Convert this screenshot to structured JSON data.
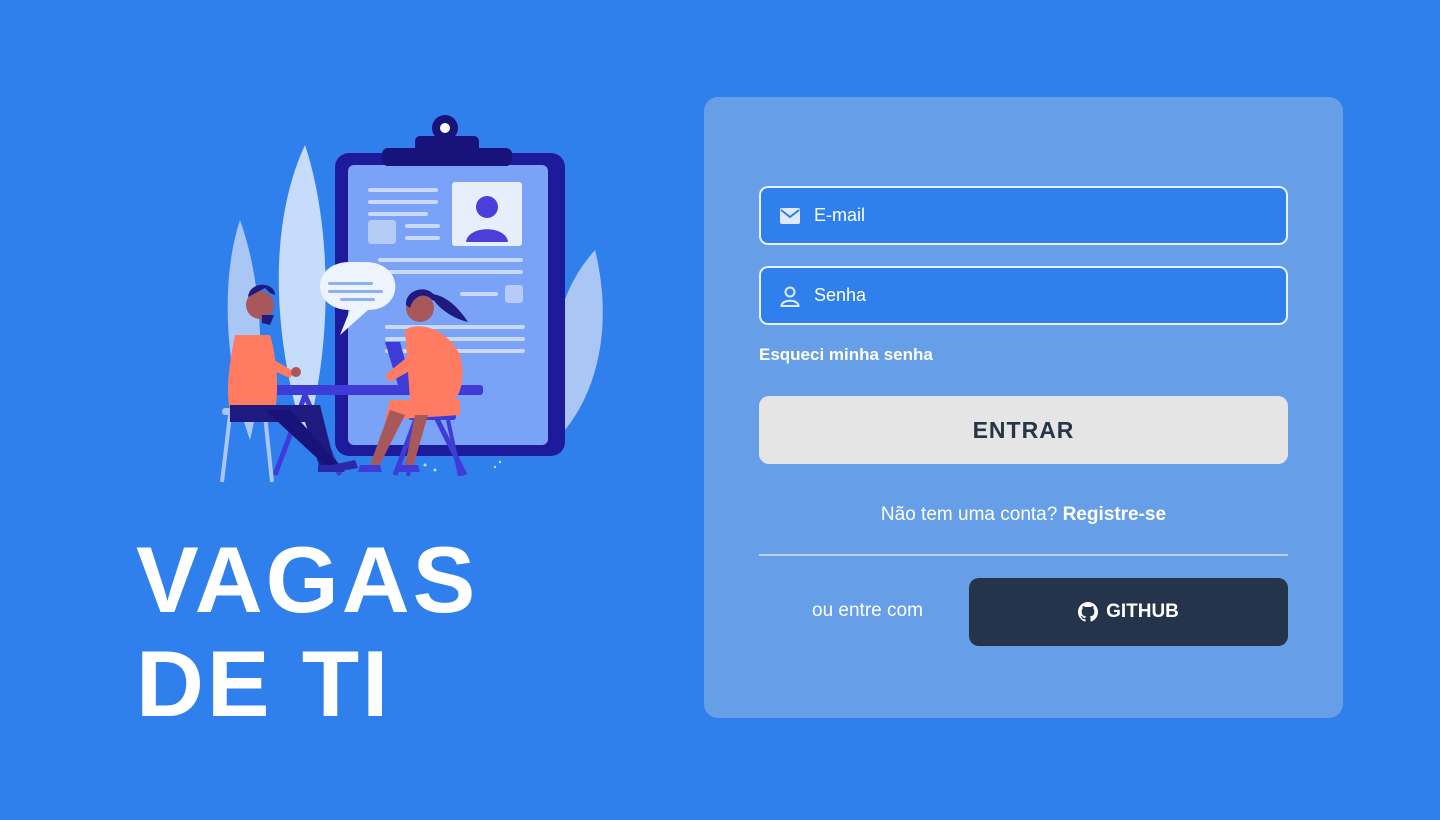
{
  "brand": {
    "title_line1": "VAGAS",
    "title_line2": "DE TI"
  },
  "illustration": {
    "subject": "job interview at table with clipboard resume"
  },
  "login": {
    "email": {
      "placeholder": "E-mail",
      "value": "",
      "icon": "mail-icon"
    },
    "password": {
      "placeholder": "Senha",
      "value": "",
      "icon": "user-icon"
    },
    "forgot_password": "Esqueci minha senha",
    "submit_label": "ENTRAR",
    "register_prompt": "Não tem uma conta?",
    "register_link": "Registre-se",
    "alt_login_text": "ou entre com",
    "github_label": "GITHUB",
    "github_icon": "github-icon"
  },
  "colors": {
    "background": "#2f80ed",
    "card": "#679ee8",
    "input_bg": "#2f80ed",
    "submit_bg": "#e5e5e5",
    "submit_text": "#273548",
    "github_bg": "#24344a"
  }
}
